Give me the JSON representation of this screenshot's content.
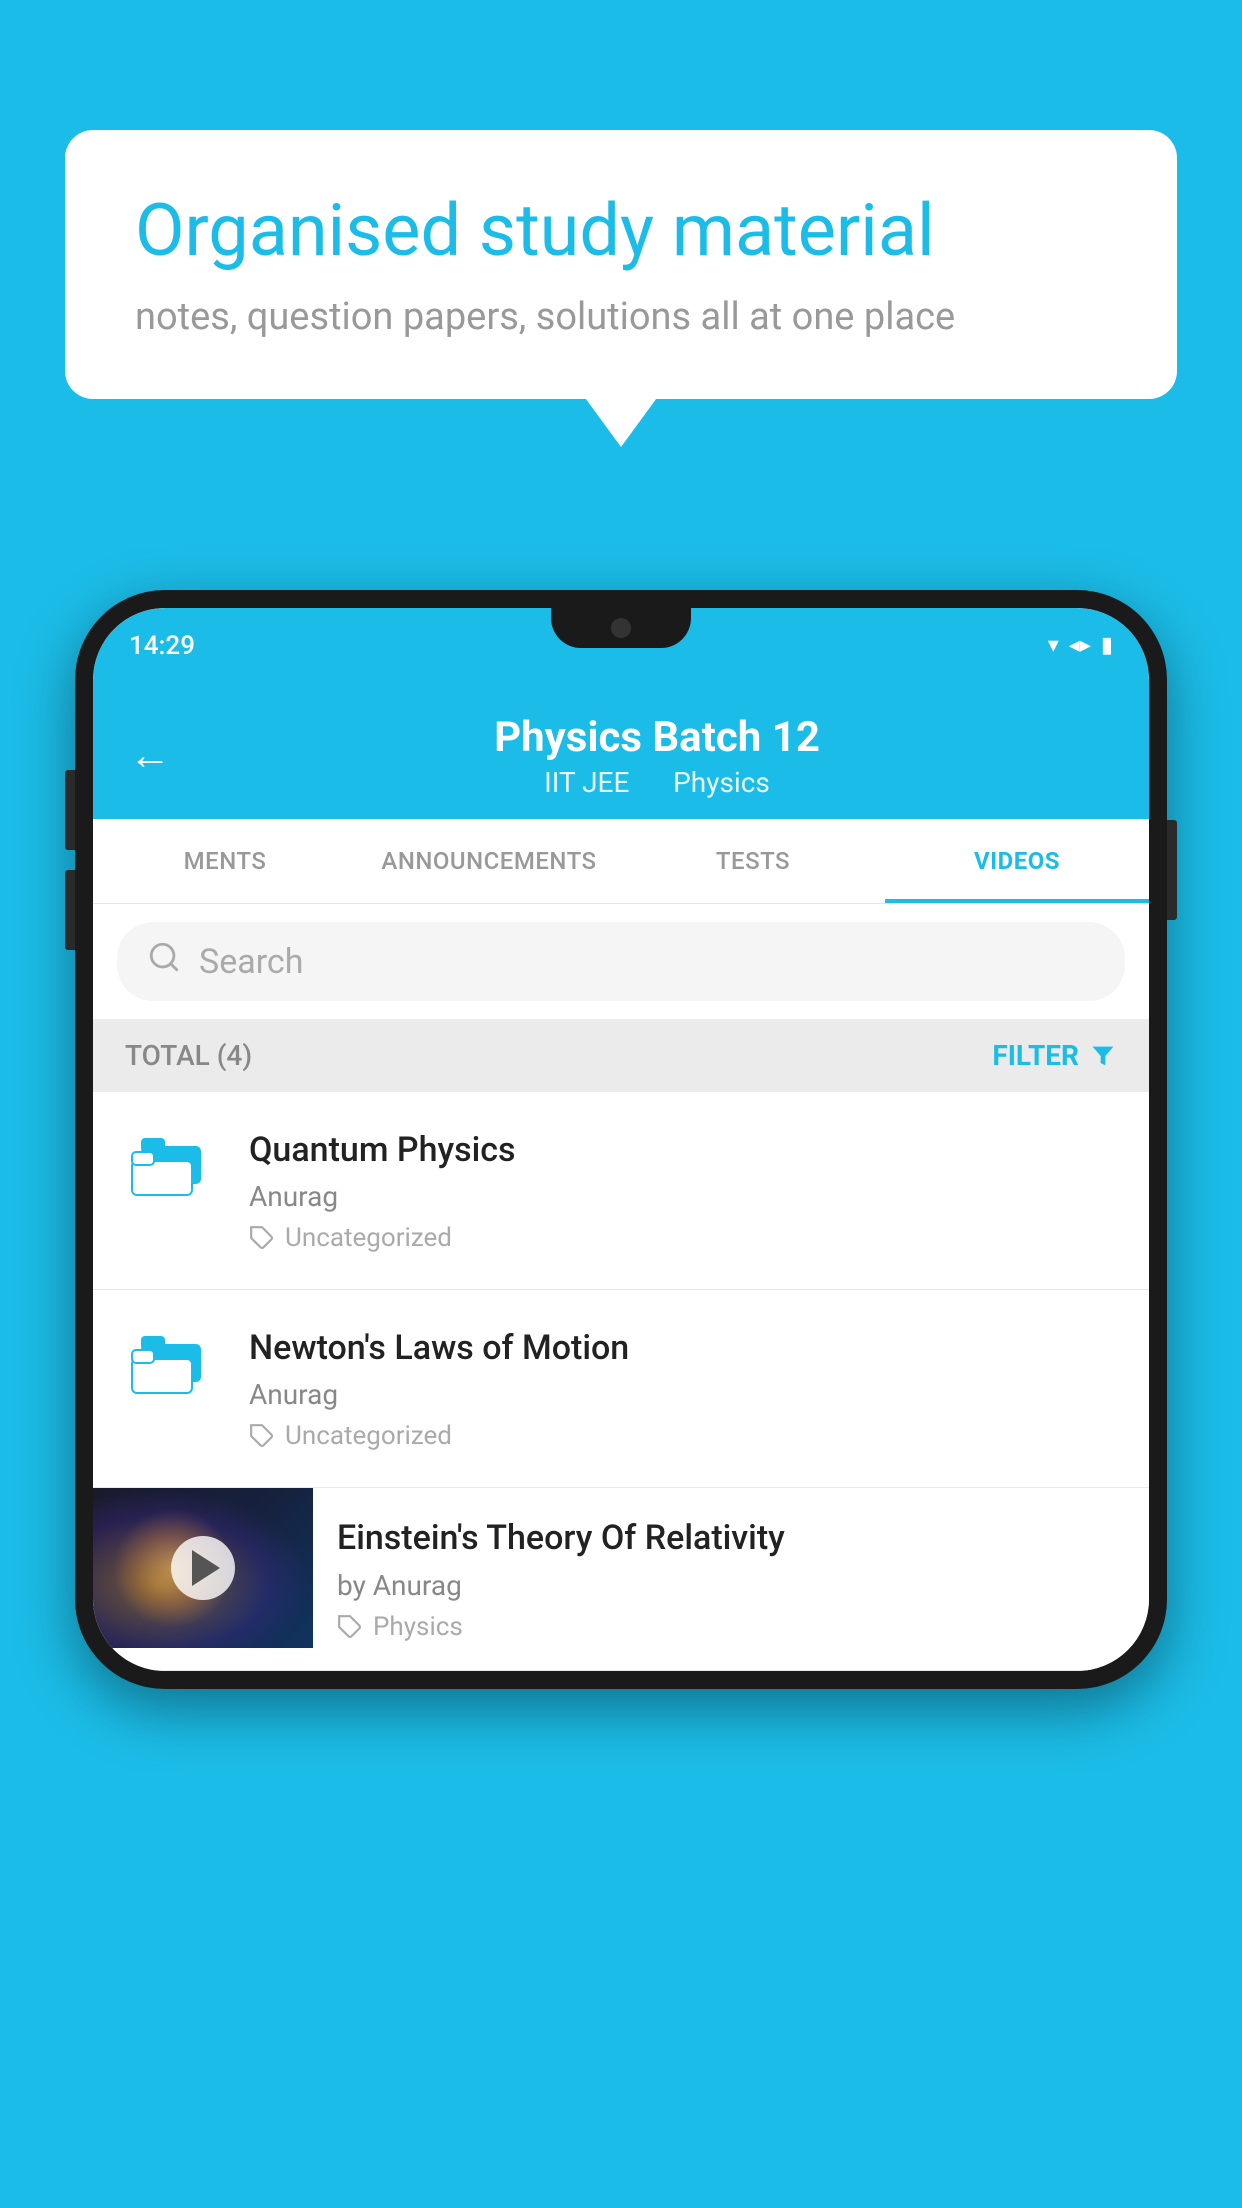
{
  "background_color": "#1bbde8",
  "speech_bubble": {
    "title": "Organised study material",
    "subtitle": "notes, question papers, solutions all at one place"
  },
  "phone": {
    "status_bar": {
      "time": "14:29"
    },
    "header": {
      "title": "Physics Batch 12",
      "subtitle_part1": "IIT JEE",
      "subtitle_part2": "Physics",
      "back_label": "←"
    },
    "tabs": [
      {
        "label": "MENTS",
        "active": false
      },
      {
        "label": "ANNOUNCEMENTS",
        "active": false
      },
      {
        "label": "TESTS",
        "active": false
      },
      {
        "label": "VIDEOS",
        "active": true
      }
    ],
    "search": {
      "placeholder": "Search"
    },
    "filter_bar": {
      "total_label": "TOTAL (4)",
      "filter_label": "FILTER"
    },
    "videos": [
      {
        "title": "Quantum Physics",
        "author": "Anurag",
        "tag": "Uncategorized",
        "has_thumbnail": false
      },
      {
        "title": "Newton's Laws of Motion",
        "author": "Anurag",
        "tag": "Uncategorized",
        "has_thumbnail": false
      },
      {
        "title": "Einstein's Theory Of Relativity",
        "author": "by Anurag",
        "tag": "Physics",
        "has_thumbnail": true
      }
    ]
  }
}
